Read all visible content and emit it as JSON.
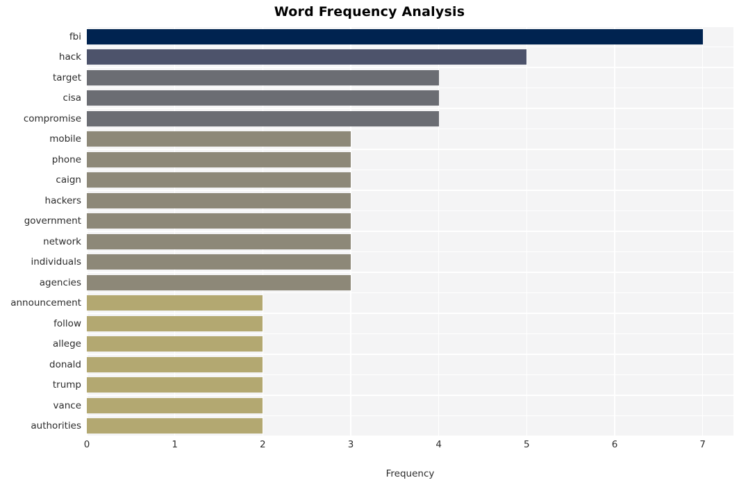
{
  "chart_data": {
    "type": "bar",
    "orientation": "horizontal",
    "title": "Word Frequency Analysis",
    "xlabel": "Frequency",
    "ylabel": "",
    "xlim": [
      0,
      7.35
    ],
    "xticks": [
      0,
      1,
      2,
      3,
      4,
      5,
      6,
      7
    ],
    "grid": true,
    "legend": null,
    "categories": [
      "fbi",
      "hack",
      "target",
      "cisa",
      "compromise",
      "mobile",
      "phone",
      "caign",
      "hackers",
      "government",
      "network",
      "individuals",
      "agencies",
      "announcement",
      "follow",
      "allege",
      "donald",
      "trump",
      "vance",
      "authorities"
    ],
    "values": [
      7,
      5,
      4,
      4,
      4,
      3,
      3,
      3,
      3,
      3,
      3,
      3,
      3,
      2,
      2,
      2,
      2,
      2,
      2,
      2
    ],
    "bar_colors": [
      "#002350",
      "#4d536b",
      "#6b6d73",
      "#6b6d73",
      "#6b6d73",
      "#8d8878",
      "#8d8878",
      "#8d8878",
      "#8d8878",
      "#8d8878",
      "#8d8878",
      "#8d8878",
      "#8d8878",
      "#b3a871",
      "#b3a871",
      "#b3a871",
      "#b3a871",
      "#b3a871",
      "#b3a871",
      "#b3a871"
    ],
    "plot_background": "#f4f4f5",
    "grid_color": "#ffffff",
    "text_color": "#2b2b2b"
  }
}
